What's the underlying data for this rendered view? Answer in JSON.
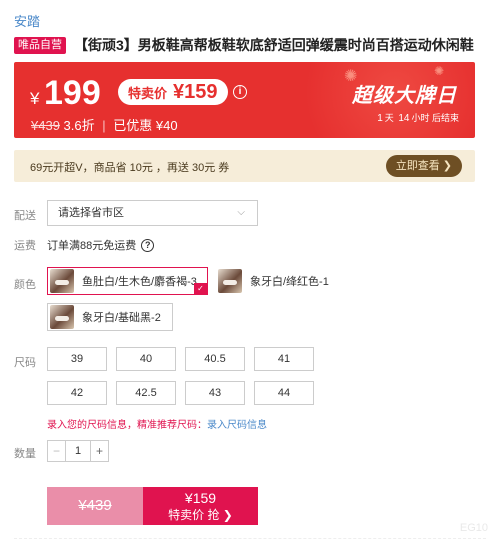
{
  "brand": "安踏",
  "product": {
    "tag": "唯品自营",
    "title": "【街顽3】男板鞋高帮板鞋软底舒适回弹缓震时尚百搭运动休闲鞋"
  },
  "promo": {
    "yen": "¥",
    "price": "199",
    "sale_label": "特卖价",
    "sale_price": "¥159",
    "info_icon": "i",
    "orig_price": "¥439",
    "discount": "3.6折",
    "separator": "|",
    "saved": "已优惠 ¥40",
    "event": "超级大牌日",
    "countdown": {
      "days": "1",
      "days_unit": "天",
      "hours": "14",
      "hours_unit": "小时",
      "suffix": "后结束"
    }
  },
  "vip": {
    "text": "69元开超V，商品省 10元 ，再送 30元 券",
    "button": "立即查看 ❯"
  },
  "delivery": {
    "label": "配送",
    "placeholder": "请选择省市区",
    "chevron": "⌵"
  },
  "freight": {
    "label": "运费",
    "text": "订单满88元免运费",
    "help_icon": "?"
  },
  "color": {
    "label": "颜色",
    "options": [
      {
        "name": "鱼肚白/生木色/麝香褐-3",
        "selected": true
      },
      {
        "name": "象牙白/绛红色-1",
        "selected": false
      },
      {
        "name": "象牙白/基础黑-2",
        "selected": false
      }
    ]
  },
  "size": {
    "label": "尺码",
    "options": [
      "39",
      "40",
      "40.5",
      "41",
      "42",
      "42.5",
      "43",
      "44"
    ],
    "tip": "录入您的尺码信息，精准推荐尺码：",
    "tip_link": "录入尺码信息"
  },
  "quantity": {
    "label": "数量",
    "minus": "−",
    "value": "1",
    "plus": "+"
  },
  "buy": {
    "orig_price": "¥439",
    "price": "¥159",
    "action": "特卖价 抢 ❯"
  },
  "watermark": "EG10",
  "colors": {
    "accent": "#e0134f",
    "promo_red": "#e6302f",
    "link": "#4a88c9",
    "vip_bg": "#f6edd9"
  }
}
